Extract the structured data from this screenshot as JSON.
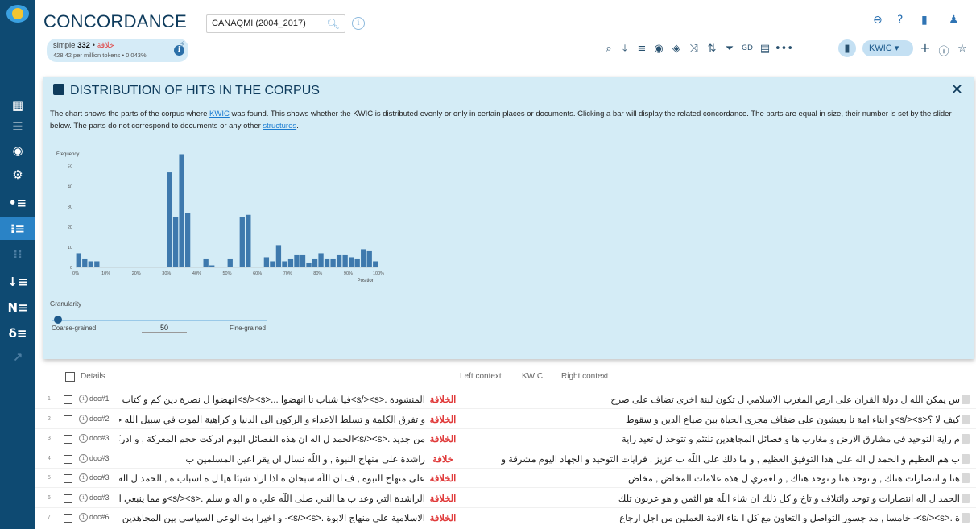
{
  "app": {
    "title": "CONCORDANCE",
    "corpus": "CANAQMI (2004_2017)"
  },
  "hits": {
    "query_prefix": "simple",
    "query_word": "خلافة",
    "count": "332",
    "per_million": "428.42 per million tokens • 0.043%"
  },
  "toolbar": {
    "view_mode": "KWIC ▾"
  },
  "distribution": {
    "title": "DISTRIBUTION OF HITS IN THE CORPUS",
    "desc_1": "The chart shows the parts of the corpus where ",
    "desc_link_1": "KWIC",
    "desc_2": " was found. This shows whether the KWIC is distributed evenly or only in certain places or documents. Clicking a bar will display the related concordance. The parts are equal in size, their number is set by the slider below. The parts do not correspond to documents or any other ",
    "desc_link_2": "structures",
    "desc_3": ".",
    "granularity_label": "Granularity",
    "slider_left": "Coarse-grained",
    "slider_right": "Fine-grained",
    "slider_value": "50",
    "slider_level": 0.03
  },
  "chart_data": {
    "type": "bar",
    "ylabel": "Frequency",
    "xlabel": "Position",
    "ylim": [
      0,
      55
    ],
    "yticks": [
      "0",
      "10",
      "20",
      "30",
      "40",
      "50"
    ],
    "xticks": [
      "0%",
      "10%",
      "20%",
      "30%",
      "40%",
      "50%",
      "60%",
      "70%",
      "80%",
      "90%",
      "100%"
    ],
    "grid": false,
    "values": [
      7,
      4,
      3,
      3,
      0,
      0,
      0,
      0,
      0,
      0,
      0,
      0,
      0,
      0,
      0,
      47,
      25,
      56,
      27,
      0,
      0,
      4,
      1,
      0,
      0,
      4,
      0,
      25,
      26,
      0,
      0,
      5,
      3,
      11,
      3,
      4,
      6,
      6,
      2,
      4,
      7,
      4,
      4,
      6,
      6,
      5,
      4,
      9,
      8,
      3
    ]
  },
  "concordance": {
    "col_details": "Details",
    "col_left": "Left context",
    "col_kwic": "KWIC",
    "col_right": "Right context",
    "rows": [
      {
        "num": "1",
        "ref": "doc#1",
        "left": "المنشودة .<s/><s>فيا شباب نا انهضوا ...<s/><s>انهضوا ل نصرة دين كم و كتاب رب كم",
        "kwic": "الخلافة",
        "right": "س يمكن الله ل دولة القران على ارض المغرب الاسلامي ل تكون لبنة اخرى تضاف على صرح"
      },
      {
        "num": "2",
        "ref": "doc#2",
        "left": "و تفرق الكلمة و تسلط الاعداء و الركون الى الدنيا و كراهية الموت في سبيل الله حتى حقت",
        "kwic": "الخلافة",
        "right": "كيف لا ؟<s/><s>و ابناء امة نا يعيشون على ضفاف مجرى الحياة بين ضياع الدين و سقوط"
      },
      {
        "num": "3",
        "ref": "doc#3",
        "left": "من جديد .<s/><s>الحمد ل اله ان هذه الفصائل اليوم ادركت حجم المعركة , و ادركت تحديا",
        "kwic": "الخلافة",
        "right": "م راية التوحيد في مشارق الارض و مغارب ها و فصائل المجاهدين تلتئم و تتوحد ل تعيد راية"
      },
      {
        "num": "4",
        "ref": "doc#3",
        "left": "راشدة على منهاج النبوة , و اللّه نسال ان يقر اعين المسلمين ب",
        "kwic": "خلافة",
        "right": "ب هم العظيم و الحمد ل اله على هذا التوفيق العظيم , و ما ذلك على اللّه ب عزيز , فرايات التوحيد و الجهاد اليوم مشرقة و"
      },
      {
        "num": "5",
        "ref": "doc#3",
        "left": "على منهاج النبوة , ف ان اللّه سبحان ه اذا اراد شيئا هيا ل ه اسباب ه , الحمد ل اله انتصارات",
        "kwic": "الخلافة",
        "right": "هنا و انتصارات هناك , و توحد هنا و توحد هناك , و لعمري ل هذه علامات المخاض , مخاض"
      },
      {
        "num": "6",
        "ref": "doc#3",
        "left": "الراشدة التي وعد ب ها النبي صلى اللّه علي ه و اله و سلم .<s/><s>و مما ينبغي ان اذكر ب",
        "kwic": "الخلافة",
        "right": "الحمد ل اله انتصارات و توحد وائتلاف و تاخ و كل ذلك ان شاء اللّه هو الثمن و هو عربون تلك"
      },
      {
        "num": "7",
        "ref": "doc#6",
        "left": "الاسلامية على منهاج الابوة .<s/><s>- و اخيرا بث الوعي السياسي بين المجاهدين .<s/><s>",
        "kwic": "الخلافة",
        "right": "ة .<s/><s>- خامسا , مد جسور التواصل و التعاون مع كل ا بناء الامة العملين من اجل ارجاع"
      }
    ]
  }
}
